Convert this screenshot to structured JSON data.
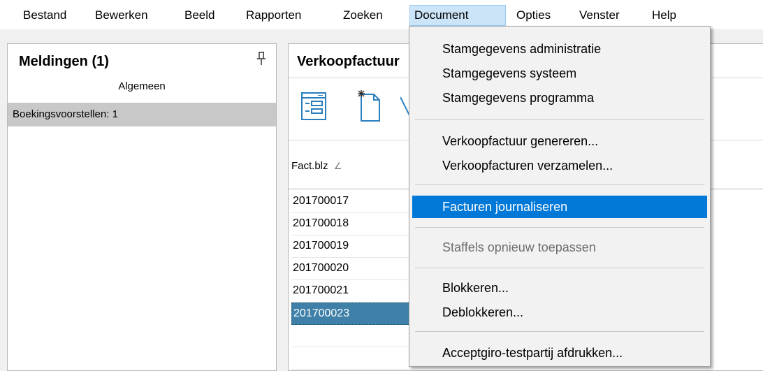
{
  "menubar": {
    "items": [
      "Bestand",
      "Bewerken",
      "Beeld",
      "Rapporten",
      "Zoeken",
      "Document",
      "Opties",
      "Venster",
      "Help"
    ],
    "active": "Document"
  },
  "meldingen": {
    "title": "Meldingen  (1)",
    "tab": "Algemeen",
    "row": "Boekingsvoorstellen: 1",
    "pin_icon": "pin-icon"
  },
  "document_panel": {
    "title": "Verkoopfactuur",
    "toolbar_icons": [
      "form-view-icon",
      "new-document-icon",
      "close-icon"
    ],
    "column_header": "Fact.blz",
    "sort_icon": "sort-ascending-icon",
    "rows": [
      "201700017",
      "201700018",
      "201700019",
      "201700020",
      "201700021",
      "201700023"
    ],
    "selected_row": "201700023"
  },
  "dropdown": {
    "items": [
      "Stamgegevens administratie",
      "Stamgegevens systeem",
      "Stamgegevens programma",
      "Verkoopfactuur genereren...",
      "Verkoopfacturen verzamelen...",
      "Facturen journaliseren",
      "Staffels opnieuw toepassen",
      "Blokkeren...",
      "Deblokkeren...",
      "Acceptgiro-testpartij afdrukken..."
    ],
    "highlighted": "Facturen journaliseren",
    "disabled": "Staffels opnieuw toepassen"
  },
  "colors": {
    "highlight": "#0078d7",
    "selection": "#3e80a8",
    "menu_active": "#cce4f7"
  }
}
